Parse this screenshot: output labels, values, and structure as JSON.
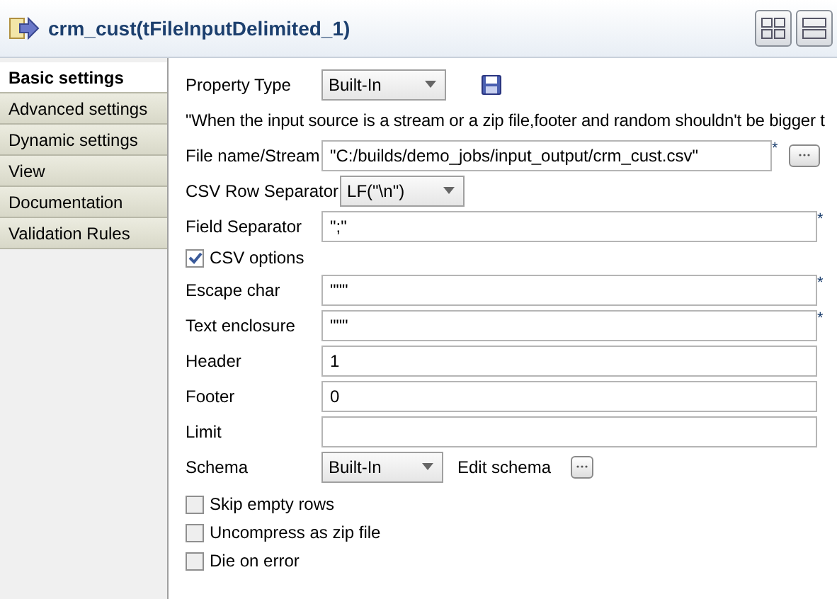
{
  "title": "crm_cust(tFileInputDelimited_1)",
  "tabs": [
    {
      "label": "Basic settings",
      "selected": true
    },
    {
      "label": "Advanced settings",
      "selected": false
    },
    {
      "label": "Dynamic settings",
      "selected": false
    },
    {
      "label": "View",
      "selected": false
    },
    {
      "label": "Documentation",
      "selected": false
    },
    {
      "label": "Validation Rules",
      "selected": false
    }
  ],
  "rows": [
    {
      "kind": "combo",
      "label": "Property Type",
      "value": "Built-In",
      "save": true
    },
    {
      "kind": "note",
      "label": "\"When the input source is a stream or a zip file,footer and random shouldn't be bigger t"
    },
    {
      "kind": "file",
      "label": "File name/Stream",
      "value": "\"C:/builds/demo_jobs/input_output/crm_cust.csv\"",
      "marker": "*"
    },
    {
      "kind": "combo",
      "label": "CSV Row Separator",
      "value": "LF(\"\\n\")"
    },
    {
      "kind": "text",
      "label": "Field Separator",
      "value": "\";\"",
      "marker": "*"
    },
    {
      "kind": "checkbox",
      "label": "CSV options",
      "checked": true
    },
    {
      "kind": "text",
      "label": "Escape char",
      "value": "\"\"\"",
      "marker": "*"
    },
    {
      "kind": "text",
      "label": "Text enclosure",
      "value": "\"\"\"",
      "marker": "*"
    },
    {
      "kind": "text",
      "label": "Header",
      "value": "1"
    },
    {
      "kind": "text",
      "label": "Footer",
      "value": "0"
    },
    {
      "kind": "text",
      "label": "Limit"
    },
    {
      "kind": "schema",
      "label": "Schema",
      "value": "Built-In",
      "button": "Edit schema"
    },
    {
      "kind": "checkbox",
      "label": "Skip empty rows",
      "checked": false
    },
    {
      "kind": "checkbox",
      "label": "Uncompress as zip file",
      "checked": false
    },
    {
      "kind": "checkbox",
      "label": "Die on error",
      "checked": false
    }
  ]
}
